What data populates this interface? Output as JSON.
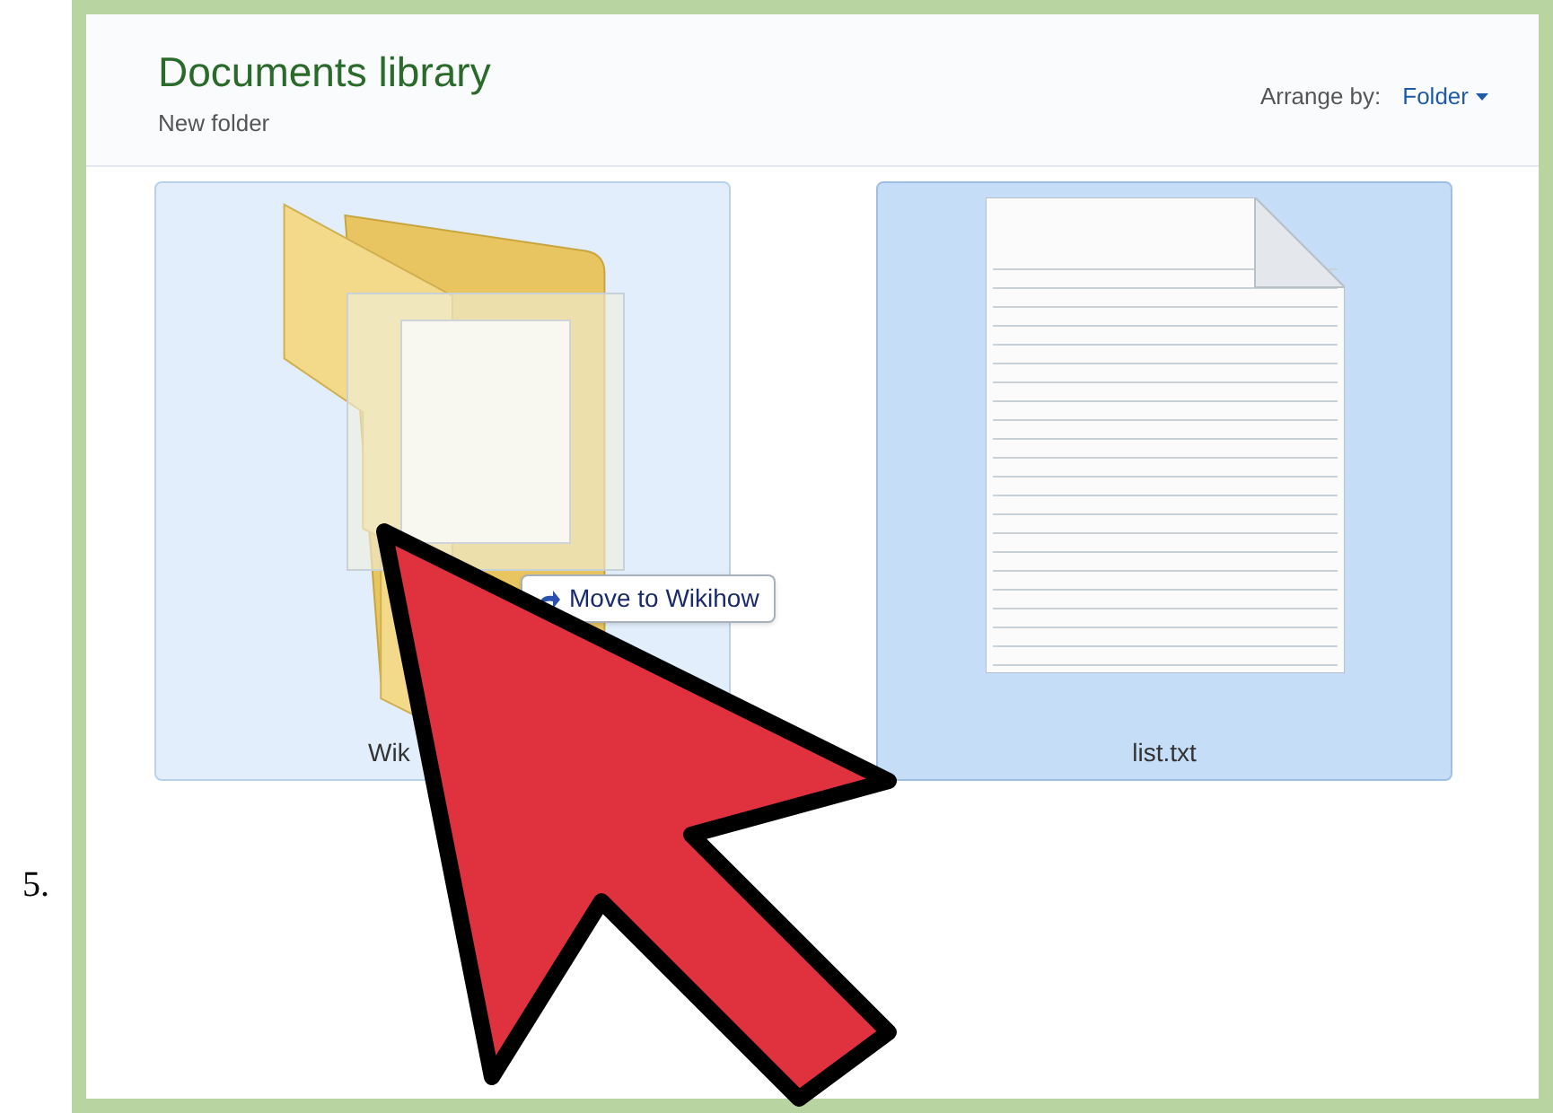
{
  "step_number": "5.",
  "library": {
    "title": "Documents library",
    "subtitle": "New folder",
    "arrange_label": "Arrange by:",
    "arrange_value": "Folder"
  },
  "items": [
    {
      "kind": "folder",
      "name": "Wik",
      "selected": false
    },
    {
      "kind": "file",
      "name": "list.txt",
      "selected": true
    }
  ],
  "drag_tooltip": "Move to Wikihow"
}
